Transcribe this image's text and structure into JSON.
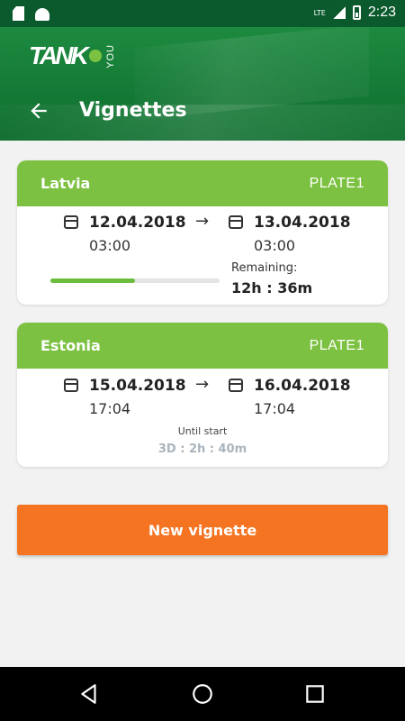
{
  "status_bar": {
    "icons": [
      "sd-card-icon",
      "android-icon"
    ],
    "network": "LTE",
    "time": "2:23"
  },
  "header": {
    "logo_text": "TANK",
    "logo_sub": "YOU",
    "title": "Vignettes",
    "back_icon": "arrow-left-icon"
  },
  "vignettes": [
    {
      "country": "Latvia",
      "plate": "PLATE1",
      "start_date": "12.04.2018",
      "start_time": "03:00",
      "end_date": "13.04.2018",
      "end_time": "03:00",
      "arrow": "→",
      "status_label": "Remaining:",
      "status_value": "12h : 36m",
      "progress_fraction": 0.5
    },
    {
      "country": "Estonia",
      "plate": "PLATE1",
      "start_date": "15.04.2018",
      "start_time": "17:04",
      "end_date": "16.04.2018",
      "end_time": "17:04",
      "arrow": "→",
      "status_label": "Until start",
      "status_value": "3D : 2h : 40m"
    }
  ],
  "actions": {
    "new_vignette": "New vignette"
  },
  "colors": {
    "header_green": "#157a36",
    "card_green": "#7dc142",
    "progress_green": "#6cbd3e",
    "button_orange": "#f47422",
    "muted_countdown": "#aab4bc"
  }
}
